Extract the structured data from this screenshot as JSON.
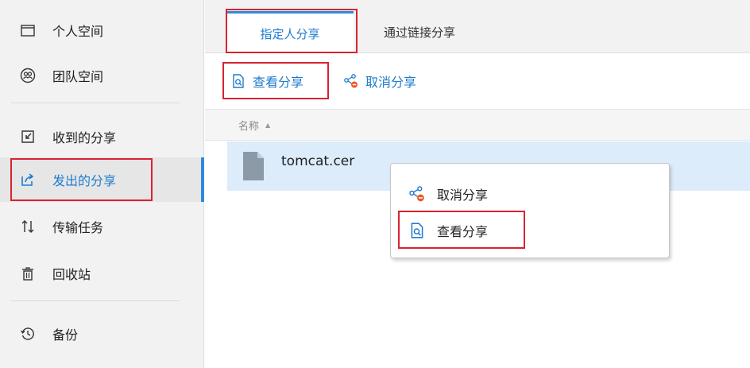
{
  "sidebar": {
    "items": [
      {
        "label": "个人空间",
        "icon": "folder-icon"
      },
      {
        "label": "团队空间",
        "icon": "team-icon"
      },
      {
        "label": "收到的分享",
        "icon": "inbox-share-icon"
      },
      {
        "label": "发出的分享",
        "icon": "outbox-share-icon"
      },
      {
        "label": "传输任务",
        "icon": "transfer-icon"
      },
      {
        "label": "回收站",
        "icon": "trash-icon"
      },
      {
        "label": "备份",
        "icon": "backup-icon"
      }
    ],
    "active_index": 3
  },
  "tabs": [
    {
      "label": "指定人分享",
      "active": true
    },
    {
      "label": "通过链接分享",
      "active": false
    }
  ],
  "toolbar": {
    "view_share_label": "查看分享",
    "cancel_share_label": "取消分享"
  },
  "list": {
    "column_name": "名称",
    "sort_indicator": "▲",
    "files": [
      {
        "name": "tomcat.cer",
        "icon": "file-icon"
      }
    ]
  },
  "context_menu": {
    "items": [
      {
        "label": "取消分享",
        "icon": "unshare-icon"
      },
      {
        "label": "查看分享",
        "icon": "view-share-icon"
      }
    ]
  },
  "colors": {
    "accent": "#2e8ae0",
    "accent_text": "#1f7ccd",
    "highlight_box": "#d9232f",
    "selected_row": "#dcecfb",
    "sidebar_bg": "#f2f2f2",
    "cancel_badge": "#ee5a24"
  }
}
